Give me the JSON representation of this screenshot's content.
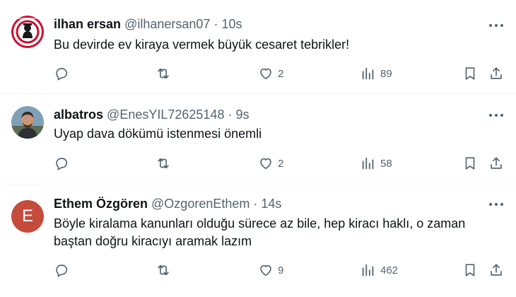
{
  "tweets": [
    {
      "name": "ilhan ersan",
      "handle": "@ilhanersan07",
      "separator": "·",
      "time": "10s",
      "text": "Bu devirde ev kiraya vermek büyük cesaret tebrikler!",
      "text_line2": "",
      "likes": "2",
      "views": "89",
      "avatar_type": "emblem"
    },
    {
      "name": "albatros",
      "handle": "@EnesYIL72625148",
      "separator": "·",
      "time": "9s",
      "text": "Uyap dava dökümü istenmesi önemli",
      "text_line2": "",
      "likes": "2",
      "views": "58",
      "avatar_type": "photo"
    },
    {
      "name": "Ethem Özgören",
      "handle": "@OzgorenEthem",
      "separator": "·",
      "time": "14s",
      "text": "Böyle kiralama kanunları olduğu sürece az bile, hep kiracı haklı, o zaman",
      "text_line2": "baştan doğru kiracıyı aramak lazım",
      "likes": "9",
      "views": "462",
      "avatar_type": "letter",
      "avatar_letter": "E",
      "avatar_color": "#c54b3b"
    }
  ],
  "icons": {
    "reply": "reply-icon",
    "retweet": "retweet-icon",
    "like": "heart-icon",
    "views": "views-icon",
    "bookmark": "bookmark-icon",
    "share": "share-icon",
    "more": "more-icon"
  },
  "colors": {
    "text_primary": "#0f1419",
    "text_secondary": "#536471",
    "divider": "#eff3f4"
  }
}
